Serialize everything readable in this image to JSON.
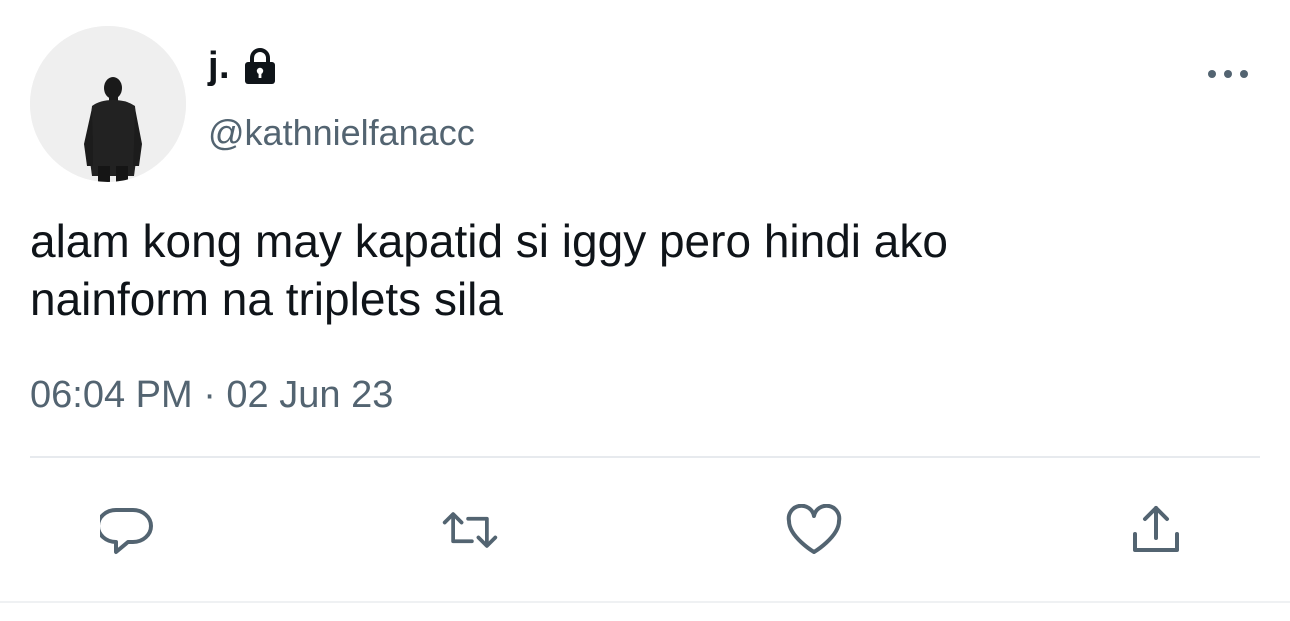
{
  "tweet": {
    "display_name": "j.",
    "handle": "@kathnielfanacc",
    "text": "alam kong may kapatid si iggy pero hindi ako\nnainform na triplets sila",
    "timestamp": "06:04 PM · 02 Jun 23"
  },
  "icons": {
    "avatar": "man-in-suit-back-view-photo",
    "lock": "lock-icon",
    "more": "more-horizontal-icon",
    "reply": "reply-icon",
    "retweet": "retweet-icon",
    "like": "heart-icon",
    "share": "share-icon"
  },
  "colors": {
    "text_primary": "#0f1419",
    "text_secondary": "#536471",
    "divider": "#e7eaee",
    "icon": "#536471"
  }
}
